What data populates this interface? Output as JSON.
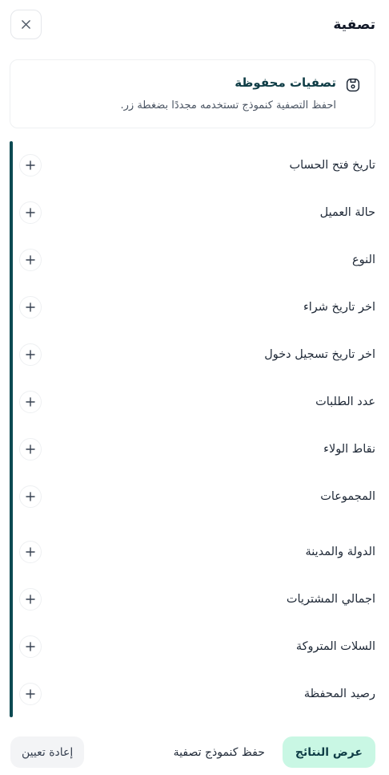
{
  "header": {
    "title": "تصفية"
  },
  "saved": {
    "title": "تصفيات محفوظة",
    "description": "احفظ التصفية كنموذج تستخدمه مجددًا بضغطة زر."
  },
  "filters": [
    {
      "label": "تاريخ فتح الحساب"
    },
    {
      "label": "حالة العميل"
    },
    {
      "label": "النوع"
    },
    {
      "label": "اخر تاريخ شراء"
    },
    {
      "label": "اخر تاريخ تسجيل دخول"
    },
    {
      "label": "عدد الطلبات"
    },
    {
      "label": "نقاط الولاء"
    },
    {
      "label": "المجموعات"
    },
    {
      "label": "الدولة والمدينة"
    },
    {
      "label": "اجمالي المشتريات"
    },
    {
      "label": "السلات المتروكة"
    },
    {
      "label": "رصيد المحفظة"
    }
  ],
  "footer": {
    "show_results": "عرض النتائج",
    "save_template": "حفظ كنموذج تصفية",
    "reset": "إعادة تعيين"
  },
  "colors": {
    "accent": "#0c4a52",
    "primary_bg": "#c9f7e4",
    "secondary_bg": "#f3f4f6"
  },
  "icons": {
    "close": "close-icon",
    "save": "save-icon",
    "plus": "plus-icon"
  }
}
